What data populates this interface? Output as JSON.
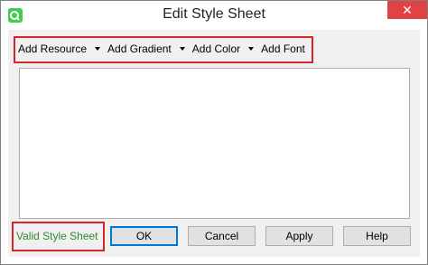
{
  "window": {
    "title": "Edit Style Sheet",
    "close_glyph": "✕",
    "app_icon": "qt-icon"
  },
  "toolbar": {
    "items": [
      {
        "label": "Add Resource"
      },
      {
        "label": "Add Gradient"
      },
      {
        "label": "Add Color"
      },
      {
        "label": "Add Font"
      }
    ]
  },
  "editor": {
    "value": ""
  },
  "status": {
    "text": "Valid Style Sheet",
    "color": "#2e8b2e"
  },
  "buttons": {
    "ok": "OK",
    "cancel": "Cancel",
    "apply": "Apply",
    "help": "Help"
  },
  "colors": {
    "highlight": "#d7262b",
    "close": "#e04343",
    "default_border": "#0078d7"
  }
}
